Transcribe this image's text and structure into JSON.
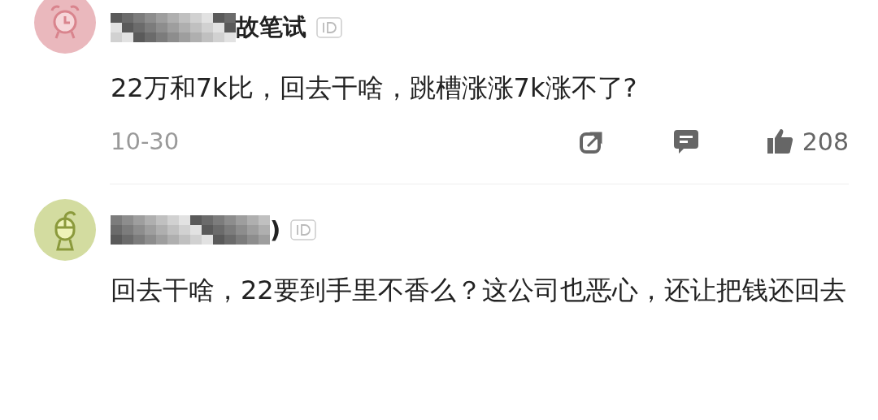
{
  "comments": [
    {
      "avatar": {
        "kind": "clock",
        "color": "#eab8bd"
      },
      "name_visible": "故笔试",
      "text": "22万和7k比，回去干啥，跳槽涨涨7k涨不了?",
      "date": "10-30",
      "likes": "208"
    },
    {
      "avatar": {
        "kind": "mouse",
        "color": "#d3dca0"
      },
      "name_visible": ")",
      "text": "回去干啥，22要到手里不香么？这公司也恶心，还让把钱还回去"
    }
  ]
}
